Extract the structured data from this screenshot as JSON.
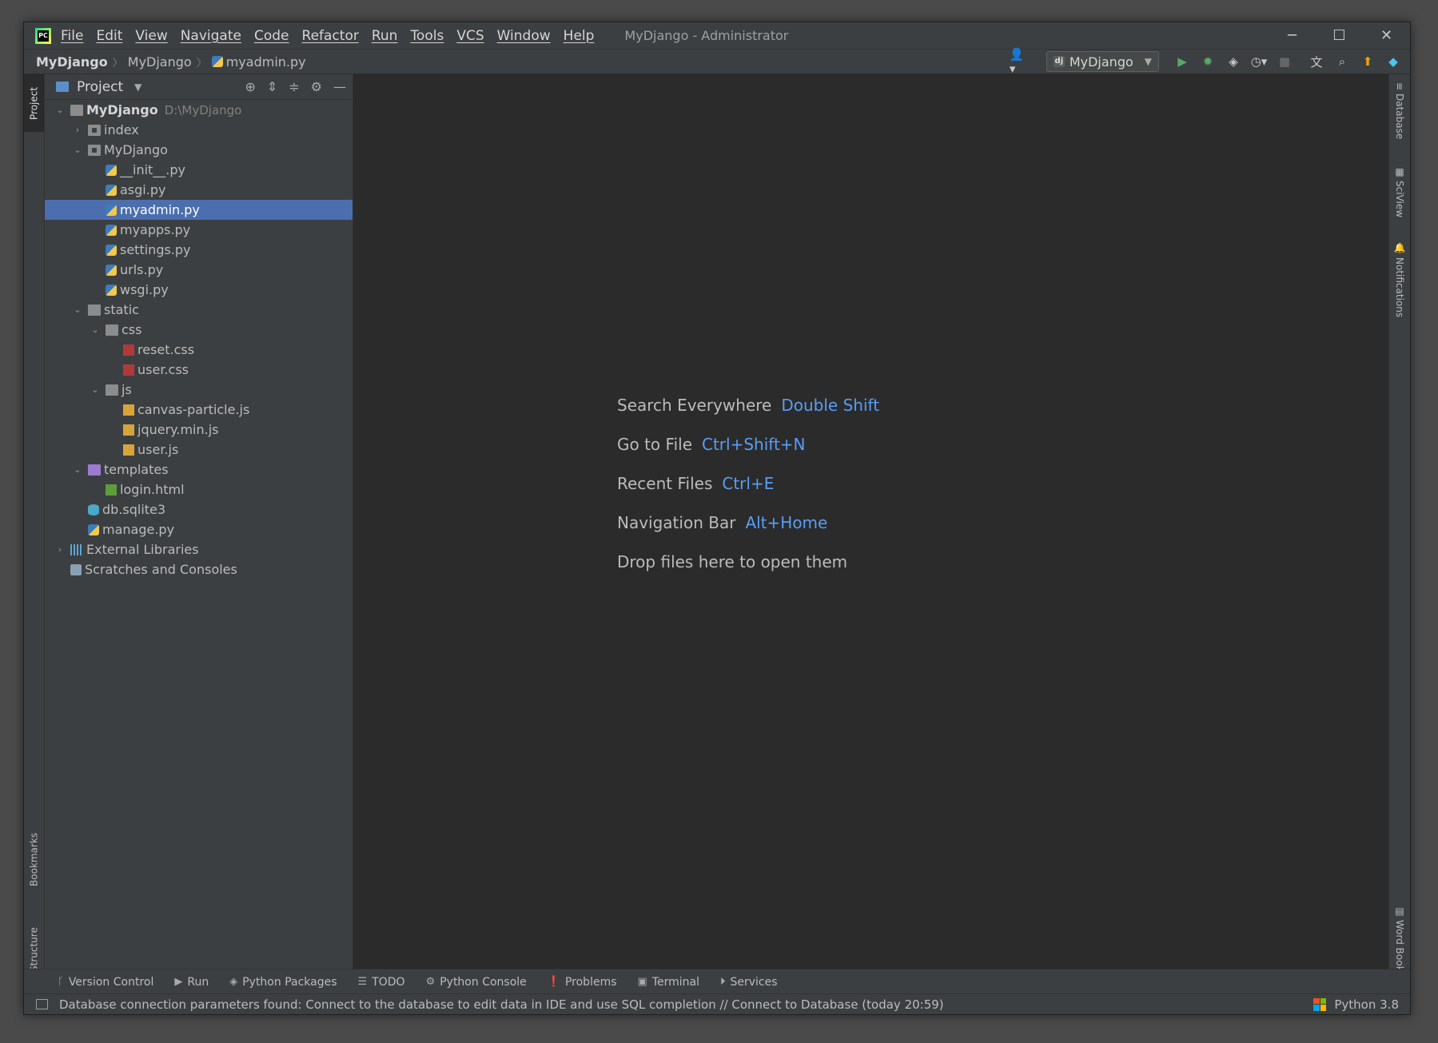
{
  "window": {
    "title": "MyDjango - Administrator",
    "menu": [
      "File",
      "Edit",
      "View",
      "Navigate",
      "Code",
      "Refactor",
      "Run",
      "Tools",
      "VCS",
      "Window",
      "Help"
    ],
    "controls": {
      "minimize": "─",
      "maximize": "☐",
      "close": "✕"
    }
  },
  "navbar": {
    "breadcrumbs": [
      "MyDjango",
      "MyDjango",
      "myadmin.py"
    ],
    "run_config": "MyDjango",
    "run_config_badge": "dj"
  },
  "left_stripe": {
    "project": "Project",
    "bookmarks": "Bookmarks",
    "structure": "Structure"
  },
  "project_panel": {
    "title": "Project",
    "tree": [
      {
        "label": "MyDjango",
        "path": "D:\\MyDjango",
        "depth": 0,
        "expand": "open",
        "icon": "folder",
        "bold": true
      },
      {
        "label": "index",
        "depth": 1,
        "expand": "closed",
        "icon": "folder-mod"
      },
      {
        "label": "MyDjango",
        "depth": 1,
        "expand": "open",
        "icon": "folder-mod"
      },
      {
        "label": "__init__.py",
        "depth": 2,
        "icon": "python-file"
      },
      {
        "label": "asgi.py",
        "depth": 2,
        "icon": "python-file"
      },
      {
        "label": "myadmin.py",
        "depth": 2,
        "icon": "python-file",
        "selected": true
      },
      {
        "label": "myapps.py",
        "depth": 2,
        "icon": "python-file"
      },
      {
        "label": "settings.py",
        "depth": 2,
        "icon": "python-file"
      },
      {
        "label": "urls.py",
        "depth": 2,
        "icon": "python-file"
      },
      {
        "label": "wsgi.py",
        "depth": 2,
        "icon": "python-file"
      },
      {
        "label": "static",
        "depth": 1,
        "expand": "open",
        "icon": "folder"
      },
      {
        "label": "css",
        "depth": 2,
        "expand": "open",
        "icon": "folder"
      },
      {
        "label": "reset.css",
        "depth": 3,
        "icon": "css-file"
      },
      {
        "label": "user.css",
        "depth": 3,
        "icon": "css-file"
      },
      {
        "label": "js",
        "depth": 2,
        "expand": "open",
        "icon": "folder"
      },
      {
        "label": "canvas-particle.js",
        "depth": 3,
        "icon": "js-file"
      },
      {
        "label": "jquery.min.js",
        "depth": 3,
        "icon": "js-file"
      },
      {
        "label": "user.js",
        "depth": 3,
        "icon": "js-file"
      },
      {
        "label": "templates",
        "depth": 1,
        "expand": "open",
        "icon": "folder-purple"
      },
      {
        "label": "login.html",
        "depth": 2,
        "icon": "html-file"
      },
      {
        "label": "db.sqlite3",
        "depth": 1,
        "icon": "database-file"
      },
      {
        "label": "manage.py",
        "depth": 1,
        "icon": "python-file"
      },
      {
        "label": "External Libraries",
        "depth": 0,
        "expand": "closed",
        "icon": "library"
      },
      {
        "label": "Scratches and Consoles",
        "depth": 0,
        "icon": "scratches"
      }
    ]
  },
  "editor": {
    "hints": [
      {
        "text": "Search Everywhere",
        "key": "Double Shift"
      },
      {
        "text": "Go to File",
        "key": "Ctrl+Shift+N"
      },
      {
        "text": "Recent Files",
        "key": "Ctrl+E"
      },
      {
        "text": "Navigation Bar",
        "key": "Alt+Home"
      },
      {
        "text": "Drop files here to open them",
        "key": ""
      }
    ]
  },
  "right_stripe": {
    "database": "Database",
    "sciview": "SciView",
    "notifications": "Notifications",
    "wordbook": "Word Book"
  },
  "bottom_tools": [
    {
      "label": "Version Control",
      "icon": "branch-icon"
    },
    {
      "label": "Run",
      "icon": "play-icon"
    },
    {
      "label": "Python Packages",
      "icon": "packages-icon"
    },
    {
      "label": "TODO",
      "icon": "list-icon"
    },
    {
      "label": "Python Console",
      "icon": "python-icon"
    },
    {
      "label": "Problems",
      "icon": "warning-icon"
    },
    {
      "label": "Terminal",
      "icon": "terminal-icon"
    },
    {
      "label": "Services",
      "icon": "services-icon"
    }
  ],
  "statusbar": {
    "message": "Database connection parameters found: Connect to the database to edit data in IDE and use SQL completion // Connect to Database (today 20:59)",
    "interpreter": "Python 3.8"
  },
  "colors": {
    "selection": "#4b6eaf",
    "shortcut": "#589df6",
    "panel_bg": "#3c3f41",
    "editor_bg": "#2b2b2b"
  }
}
